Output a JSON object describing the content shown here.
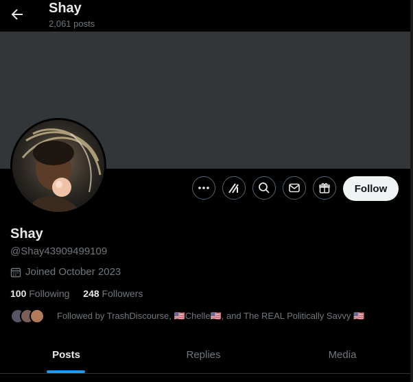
{
  "header": {
    "title": "Shay",
    "posts_count": "2,061 posts"
  },
  "profile": {
    "name": "Shay",
    "handle": "@Shay43909499109",
    "joined": "Joined October 2023",
    "following_count": "100",
    "following_label": "Following",
    "followers_count": "248",
    "followers_label": "Followers",
    "followed_by": "Followed by TrashDiscourse, 🇺🇸Chelle🇺🇸, and The REAL Politically Savvy 🇺🇸"
  },
  "actions": {
    "follow_label": "Follow"
  },
  "tabs": [
    {
      "label": "Posts"
    },
    {
      "label": "Replies"
    },
    {
      "label": "Media"
    }
  ]
}
